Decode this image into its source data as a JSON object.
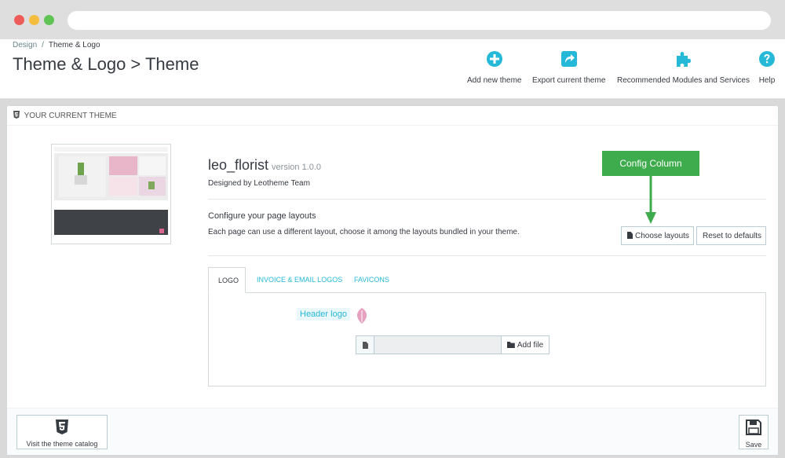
{
  "breadcrumb": {
    "parent": "Design",
    "separator": "/",
    "current": "Theme & Logo"
  },
  "page_title": "Theme & Logo > Theme",
  "toolbar": {
    "add_new_theme": "Add new theme",
    "export_current_theme": "Export current theme",
    "recommended_modules": "Recommended Modules and Services",
    "help": "Help"
  },
  "icons": {
    "add": "plus-circle-icon",
    "export": "share-icon",
    "modules": "puzzle-icon",
    "help": "question-circle-icon"
  },
  "colors": {
    "accent": "#25b9d7",
    "callout": "#3eab4d",
    "text": "#363a41"
  },
  "panel": {
    "heading": "YOUR CURRENT THEME"
  },
  "theme": {
    "name": "leo_florist",
    "version": "version 1.0.0",
    "designed_by": "Designed by Leotheme Team"
  },
  "layouts": {
    "title": "Configure your page layouts",
    "description": "Each page can use a different layout, choose it among the layouts bundled in your theme.",
    "choose_button": "Choose layouts",
    "reset_button": "Reset to defaults"
  },
  "callout": {
    "label": "Config Column"
  },
  "tabs": [
    {
      "label": "LOGO",
      "active": true
    },
    {
      "label": "INVOICE & EMAIL LOGOS",
      "active": false
    },
    {
      "label": "FAVICONS",
      "active": false
    }
  ],
  "logo_tab": {
    "header_logo_label": "Header logo",
    "add_file_button": "Add file"
  },
  "footer": {
    "catalog_button": "Visit the theme catalog",
    "save_button": "Save"
  }
}
